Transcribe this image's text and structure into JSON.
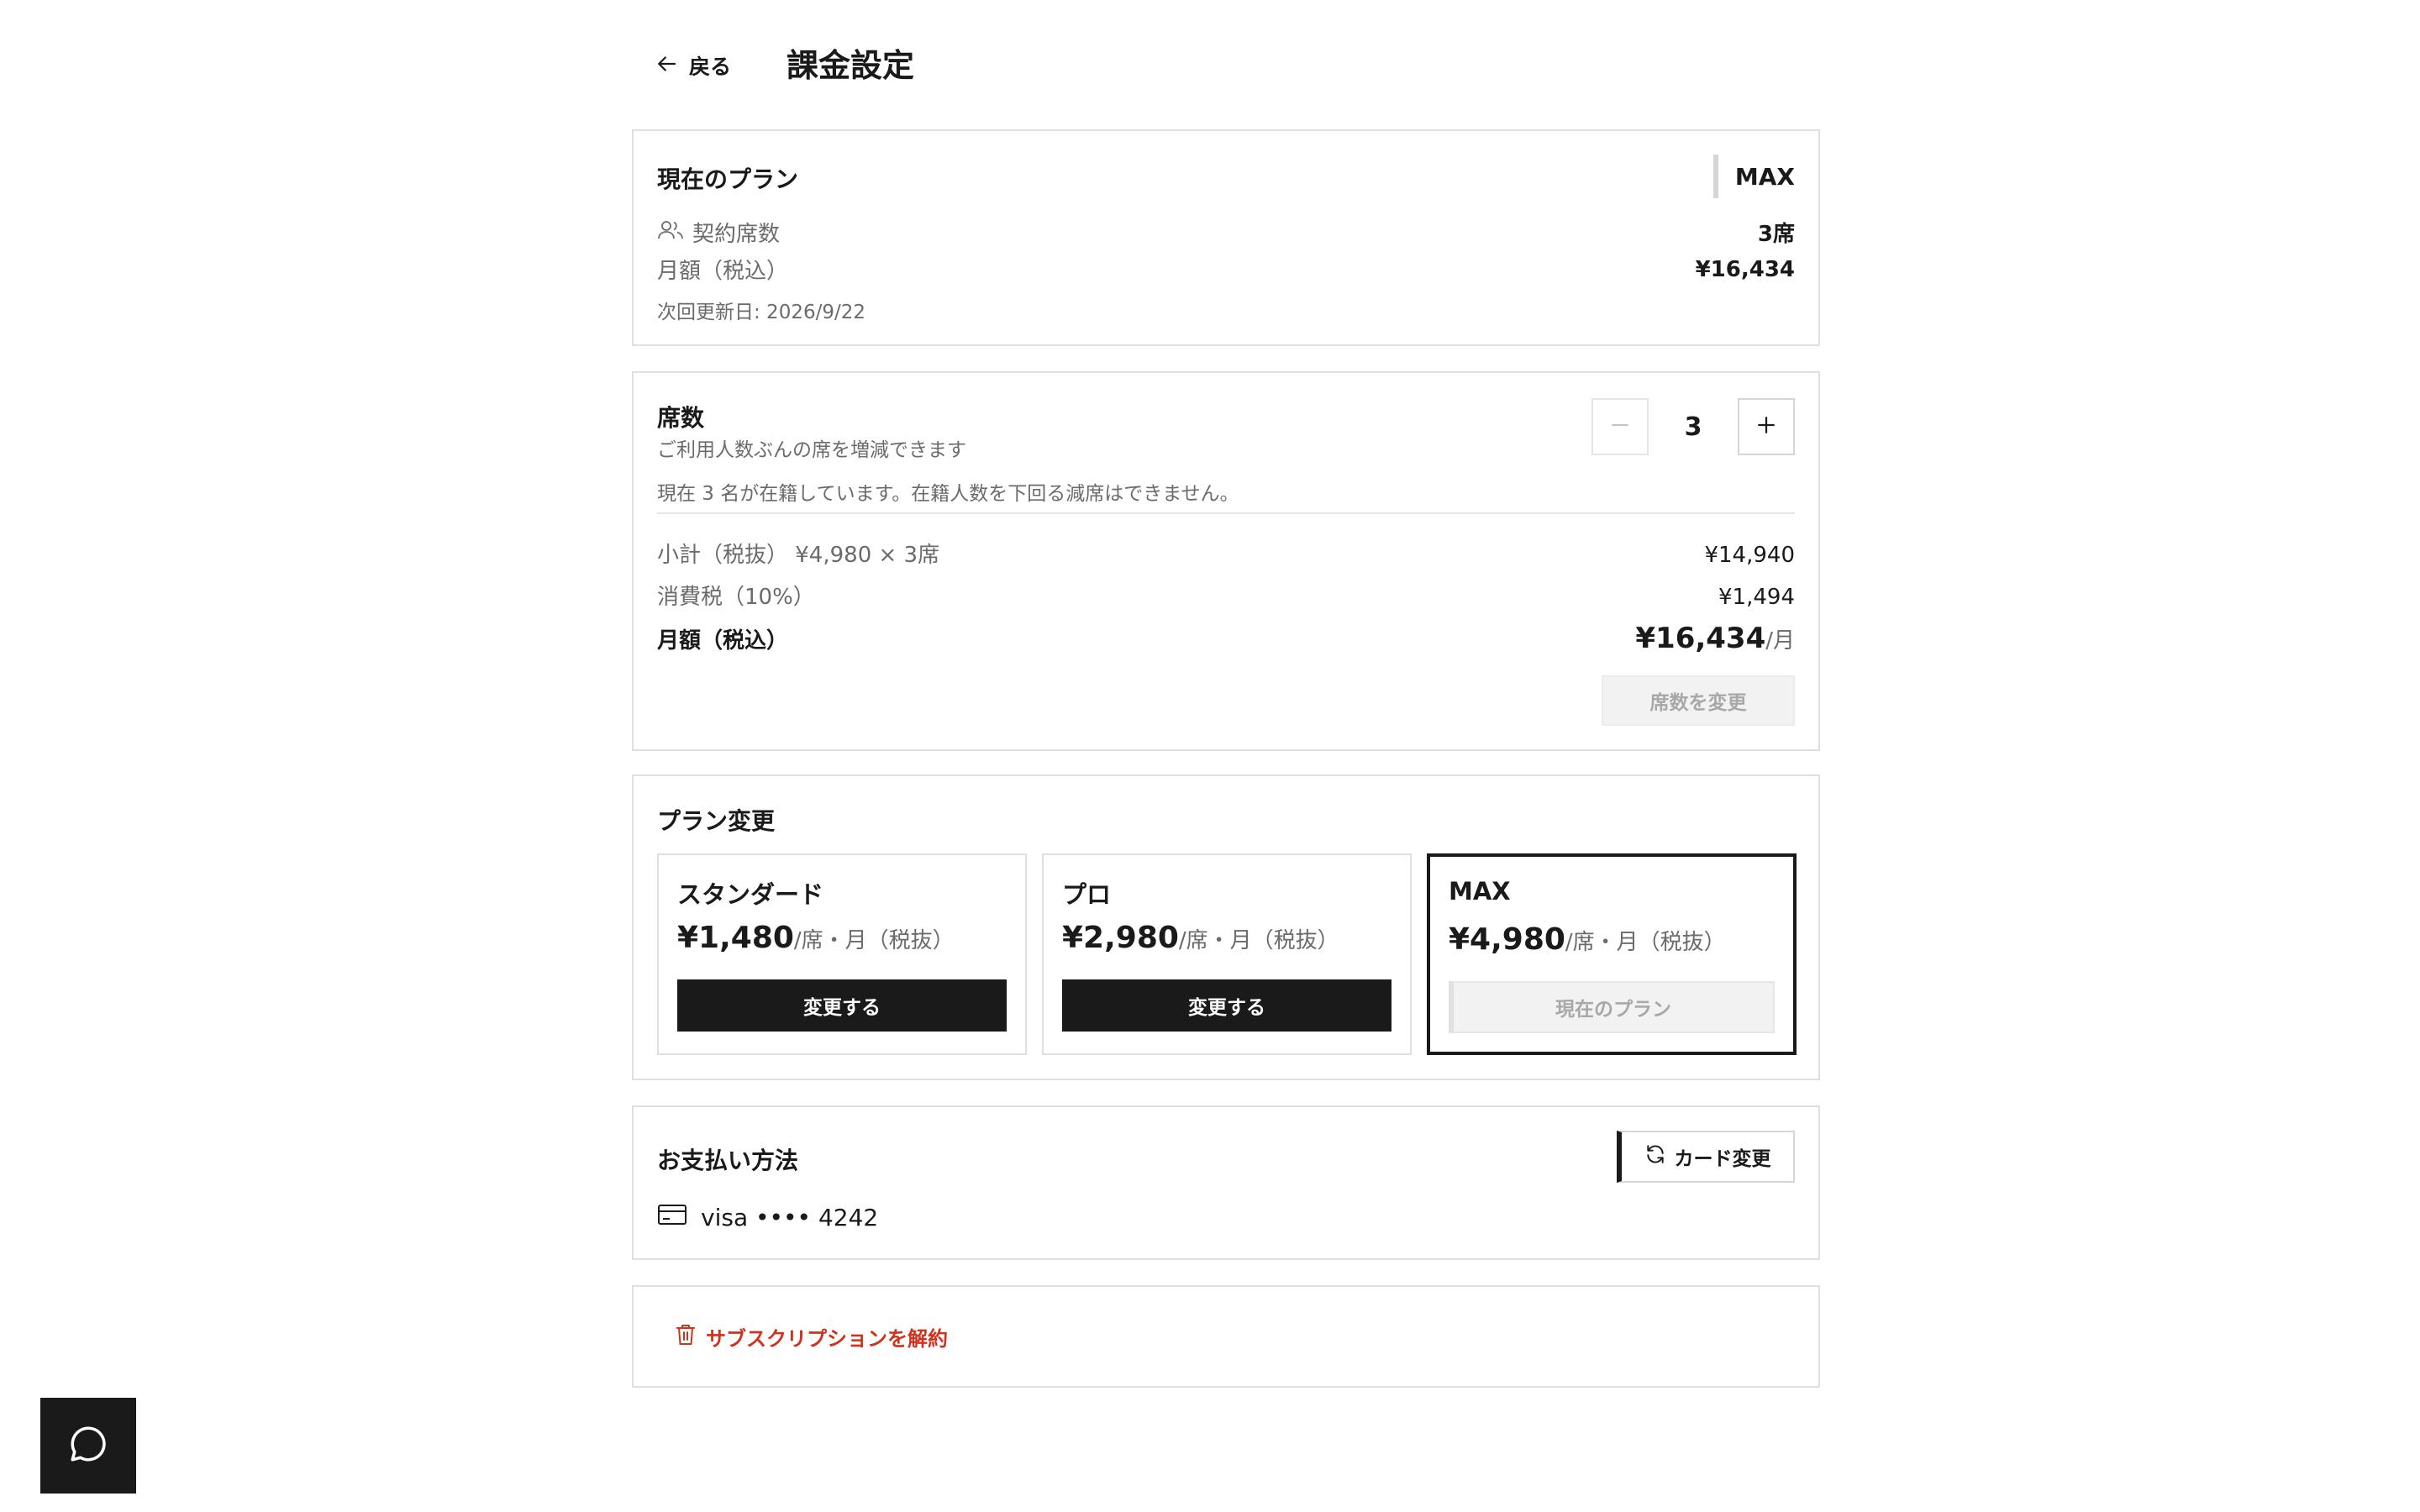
{
  "header": {
    "back_label": "戻る",
    "title": "課金設定"
  },
  "current_plan": {
    "title": "現在のプラン",
    "plan_badge": "MAX",
    "seats_label": "契約席数",
    "seats_value": "3席",
    "monthly_label": "月額（税込）",
    "monthly_value": "¥16,434",
    "next_renewal": "次回更新日: 2026/9/22"
  },
  "seats": {
    "title": "席数",
    "subtitle": "ご利用人数ぶんの席を増減できます",
    "count": "3",
    "note": "現在 3 名が在籍しています。在籍人数を下回る減席はできません。",
    "subtotal_label": "小計（税抜） ¥4,980 × 3席",
    "subtotal_value": "¥14,940",
    "tax_label": "消費税（10%）",
    "tax_value": "¥1,494",
    "total_label": "月額（税込）",
    "total_value": "¥16,434",
    "total_unit": "/月",
    "change_button": "席数を変更"
  },
  "plan_change": {
    "title": "プラン変更",
    "plans": [
      {
        "name": "スタンダード",
        "price": "¥1,480",
        "per": "/席・月（税抜）",
        "button": "変更する"
      },
      {
        "name": "プロ",
        "price": "¥2,980",
        "per": "/席・月（税抜）",
        "button": "変更する"
      },
      {
        "name": "MAX",
        "price": "¥4,980",
        "per": "/席・月（税抜）",
        "button": "現在のプラン"
      }
    ]
  },
  "payment": {
    "title": "お支払い方法",
    "change_button": "カード変更",
    "card": "visa •••• 4242"
  },
  "cancel": {
    "label": "サブスクリプションを解約"
  },
  "colors": {
    "accent": "#1a1a1a",
    "danger": "#d1321e",
    "muted_text": "#6b6b6b",
    "border": "#e0e0e0"
  },
  "icons": [
    "arrow-left-icon",
    "users-icon",
    "minus-icon",
    "plus-icon",
    "refresh-icon",
    "credit-card-icon",
    "trash-icon",
    "chat-bubble-icon"
  ]
}
